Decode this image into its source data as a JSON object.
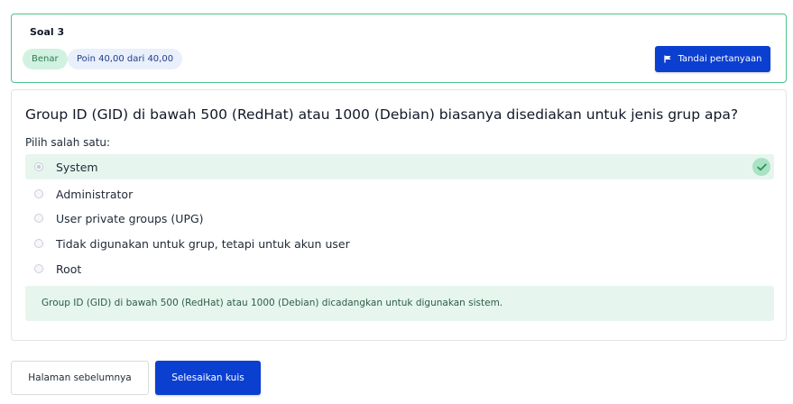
{
  "question_info": {
    "title": "Soal 3",
    "status_badge": "Benar",
    "points_badge": "Poin 40,00 dari 40,00",
    "flag_button": "Tandai pertanyaan"
  },
  "question": {
    "text": "Group ID (GID) di bawah 500 (RedHat) atau 1000 (Debian) biasanya disediakan untuk jenis grup apa?",
    "prompt": "Pilih salah satu:",
    "options": [
      {
        "label": "System",
        "selected": true,
        "correct": true
      },
      {
        "label": "Administrator",
        "selected": false
      },
      {
        "label": "User private groups (UPG)",
        "selected": false
      },
      {
        "label": "Tidak digunakan untuk grup, tetapi untuk akun user",
        "selected": false
      },
      {
        "label": "Root",
        "selected": false
      }
    ],
    "feedback": "Group ID (GID) di bawah 500 (RedHat) atau 1000 (Debian) dicadangkan untuk digunakan sistem."
  },
  "navigation": {
    "previous_button": "Halaman sebelumnya",
    "finish_button": "Selesaikan kuis"
  },
  "colors": {
    "primary": "#0b3fd0",
    "correct_border": "#4cc38a",
    "correct_background": "#e6f6ee"
  }
}
